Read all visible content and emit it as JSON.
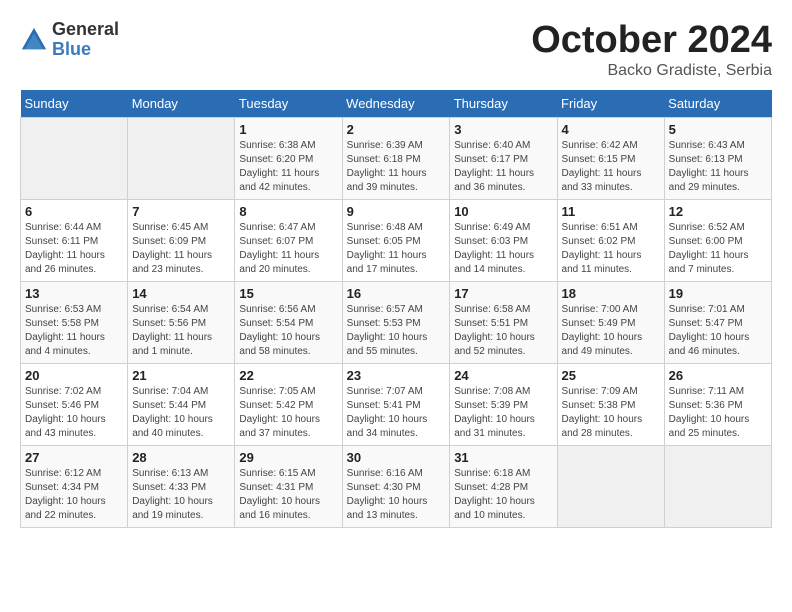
{
  "header": {
    "logo_general": "General",
    "logo_blue": "Blue",
    "month_title": "October 2024",
    "subtitle": "Backo Gradiste, Serbia"
  },
  "weekdays": [
    "Sunday",
    "Monday",
    "Tuesday",
    "Wednesday",
    "Thursday",
    "Friday",
    "Saturday"
  ],
  "weeks": [
    [
      {
        "day": "",
        "info": ""
      },
      {
        "day": "",
        "info": ""
      },
      {
        "day": "1",
        "info": "Sunrise: 6:38 AM\nSunset: 6:20 PM\nDaylight: 11 hours and 42 minutes."
      },
      {
        "day": "2",
        "info": "Sunrise: 6:39 AM\nSunset: 6:18 PM\nDaylight: 11 hours and 39 minutes."
      },
      {
        "day": "3",
        "info": "Sunrise: 6:40 AM\nSunset: 6:17 PM\nDaylight: 11 hours and 36 minutes."
      },
      {
        "day": "4",
        "info": "Sunrise: 6:42 AM\nSunset: 6:15 PM\nDaylight: 11 hours and 33 minutes."
      },
      {
        "day": "5",
        "info": "Sunrise: 6:43 AM\nSunset: 6:13 PM\nDaylight: 11 hours and 29 minutes."
      }
    ],
    [
      {
        "day": "6",
        "info": "Sunrise: 6:44 AM\nSunset: 6:11 PM\nDaylight: 11 hours and 26 minutes."
      },
      {
        "day": "7",
        "info": "Sunrise: 6:45 AM\nSunset: 6:09 PM\nDaylight: 11 hours and 23 minutes."
      },
      {
        "day": "8",
        "info": "Sunrise: 6:47 AM\nSunset: 6:07 PM\nDaylight: 11 hours and 20 minutes."
      },
      {
        "day": "9",
        "info": "Sunrise: 6:48 AM\nSunset: 6:05 PM\nDaylight: 11 hours and 17 minutes."
      },
      {
        "day": "10",
        "info": "Sunrise: 6:49 AM\nSunset: 6:03 PM\nDaylight: 11 hours and 14 minutes."
      },
      {
        "day": "11",
        "info": "Sunrise: 6:51 AM\nSunset: 6:02 PM\nDaylight: 11 hours and 11 minutes."
      },
      {
        "day": "12",
        "info": "Sunrise: 6:52 AM\nSunset: 6:00 PM\nDaylight: 11 hours and 7 minutes."
      }
    ],
    [
      {
        "day": "13",
        "info": "Sunrise: 6:53 AM\nSunset: 5:58 PM\nDaylight: 11 hours and 4 minutes."
      },
      {
        "day": "14",
        "info": "Sunrise: 6:54 AM\nSunset: 5:56 PM\nDaylight: 11 hours and 1 minute."
      },
      {
        "day": "15",
        "info": "Sunrise: 6:56 AM\nSunset: 5:54 PM\nDaylight: 10 hours and 58 minutes."
      },
      {
        "day": "16",
        "info": "Sunrise: 6:57 AM\nSunset: 5:53 PM\nDaylight: 10 hours and 55 minutes."
      },
      {
        "day": "17",
        "info": "Sunrise: 6:58 AM\nSunset: 5:51 PM\nDaylight: 10 hours and 52 minutes."
      },
      {
        "day": "18",
        "info": "Sunrise: 7:00 AM\nSunset: 5:49 PM\nDaylight: 10 hours and 49 minutes."
      },
      {
        "day": "19",
        "info": "Sunrise: 7:01 AM\nSunset: 5:47 PM\nDaylight: 10 hours and 46 minutes."
      }
    ],
    [
      {
        "day": "20",
        "info": "Sunrise: 7:02 AM\nSunset: 5:46 PM\nDaylight: 10 hours and 43 minutes."
      },
      {
        "day": "21",
        "info": "Sunrise: 7:04 AM\nSunset: 5:44 PM\nDaylight: 10 hours and 40 minutes."
      },
      {
        "day": "22",
        "info": "Sunrise: 7:05 AM\nSunset: 5:42 PM\nDaylight: 10 hours and 37 minutes."
      },
      {
        "day": "23",
        "info": "Sunrise: 7:07 AM\nSunset: 5:41 PM\nDaylight: 10 hours and 34 minutes."
      },
      {
        "day": "24",
        "info": "Sunrise: 7:08 AM\nSunset: 5:39 PM\nDaylight: 10 hours and 31 minutes."
      },
      {
        "day": "25",
        "info": "Sunrise: 7:09 AM\nSunset: 5:38 PM\nDaylight: 10 hours and 28 minutes."
      },
      {
        "day": "26",
        "info": "Sunrise: 7:11 AM\nSunset: 5:36 PM\nDaylight: 10 hours and 25 minutes."
      }
    ],
    [
      {
        "day": "27",
        "info": "Sunrise: 6:12 AM\nSunset: 4:34 PM\nDaylight: 10 hours and 22 minutes."
      },
      {
        "day": "28",
        "info": "Sunrise: 6:13 AM\nSunset: 4:33 PM\nDaylight: 10 hours and 19 minutes."
      },
      {
        "day": "29",
        "info": "Sunrise: 6:15 AM\nSunset: 4:31 PM\nDaylight: 10 hours and 16 minutes."
      },
      {
        "day": "30",
        "info": "Sunrise: 6:16 AM\nSunset: 4:30 PM\nDaylight: 10 hours and 13 minutes."
      },
      {
        "day": "31",
        "info": "Sunrise: 6:18 AM\nSunset: 4:28 PM\nDaylight: 10 hours and 10 minutes."
      },
      {
        "day": "",
        "info": ""
      },
      {
        "day": "",
        "info": ""
      }
    ]
  ]
}
